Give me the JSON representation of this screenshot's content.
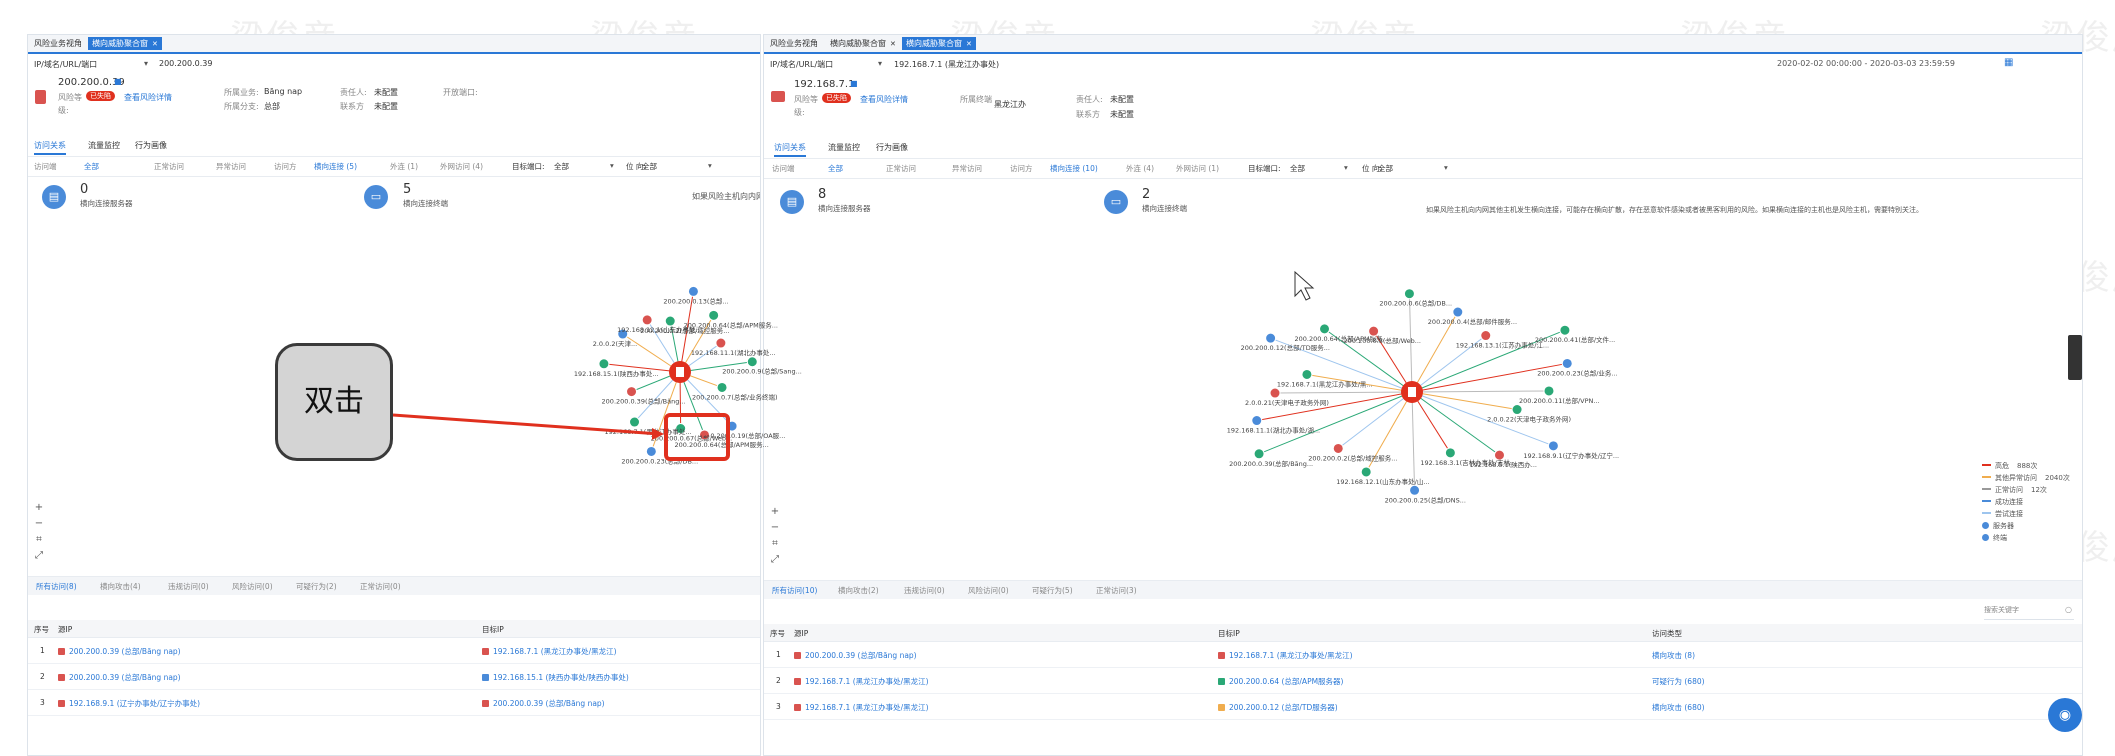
{
  "left": {
    "tabs": [
      "风险业务视角",
      "横向威胁聚合窗"
    ],
    "breadcrumb": {
      "label": "IP/域名/URL/端口",
      "value": "200.200.0.39"
    },
    "host": {
      "ip": "200.200.0.39",
      "risk_label": "风险等",
      "risk_badge": "已失陷",
      "risk_link": "查看风险详情",
      "fields": [
        {
          "k": "所属业务:",
          "v": "Băng nap"
        },
        {
          "k": "所属分支:",
          "v": "总部"
        },
        {
          "k": "责任人:",
          "v": "未配置"
        },
        {
          "k": "联系方",
          "v": "未配置"
        },
        {
          "k": "开放端口:",
          "v": ""
        }
      ],
      "extra_label": "级:"
    },
    "view_tabs": [
      "访问关系",
      "流量监控",
      "行为画像"
    ],
    "filter": {
      "group1_label": "访问端",
      "group1": [
        "全部",
        "正常访问",
        "异常访问"
      ],
      "group2_label": "访问方",
      "group2": [
        "横向连接 (5)",
        "外连 (1)",
        "外网访问 (4)"
      ],
      "dest_label": "目标端口:",
      "dest_value": "全部",
      "pos_label": "位\n向:",
      "pos_value": "全部"
    },
    "stats": [
      {
        "num": "0",
        "label": "横向连接服务器"
      },
      {
        "num": "5",
        "label": "横向连接终端"
      }
    ],
    "hint": "如果风险主机向内网",
    "bottom_tabs": [
      "所有访问(8)",
      "横向攻击(4)",
      "违规访问(0)",
      "风险访问(0)",
      "可疑行为(2)",
      "正常访问(0)"
    ],
    "table": {
      "headers": [
        "序号",
        "源IP",
        "目标IP"
      ],
      "rows": [
        {
          "n": "1",
          "src": "200.200.0.39 (总部/Băng nap)",
          "src_color": "#d9534f",
          "dst": "192.168.7.1 (黑龙江办事处/黑龙江)",
          "dst_color": "#d9534f"
        },
        {
          "n": "2",
          "src": "200.200.0.39 (总部/Băng nap)",
          "src_color": "#d9534f",
          "dst": "192.168.15.1 (陕西办事处/陕西办事处)",
          "dst_color": "#4a8bd9"
        },
        {
          "n": "3",
          "src": "192.168.9.1 (辽宁办事处/辽宁办事处)",
          "src_color": "#d9534f",
          "dst": "200.200.0.39 (总部/Băng nap)",
          "dst_color": "#d9534f"
        }
      ]
    },
    "graph_labels": [
      "200.200.0.7(总部/业务终端)",
      "200.200.0.19(总部/OA服...",
      "200.200.0.64(总部/APM服务...",
      "200.200.0.67(总部/Web...",
      "200.200.0.23(总部/DB...",
      "192.168.7.1(黑龙江办事处...",
      "200.200.0.39(总部/Băng...",
      "192.168.15.1(陕西办事处...",
      "2.0.0.2(天津...",
      "192.168.12.1(山东办事处...",
      "200.200.0.2(总部/域控服务...",
      "200.200.0.13(总部...",
      "200.200.0.64(总部/APM服务...",
      "192.168.11.1(湖北办事处...",
      "200.200.0.9(总部/Sang..."
    ]
  },
  "right": {
    "tabs": [
      "风险业务视角",
      "横向威胁聚合窗",
      "横向威胁聚合窗"
    ],
    "breadcrumb": {
      "label": "IP/域名/URL/端口",
      "value": "192.168.7.1 (黑龙江办事处)"
    },
    "date_range": "2020-02-02 00:00:00 - 2020-03-03 23:59:59",
    "host": {
      "ip": "192.168.7.1",
      "risk_label": "风险等",
      "risk_badge": "已失陷",
      "risk_link": "查看风险详情",
      "fields": [
        {
          "k": "所属终端",
          "v": "黑龙江办"
        },
        {
          "k": "责任人:",
          "v": "未配置"
        },
        {
          "k": "联系方",
          "v": "未配置"
        }
      ],
      "extra_label": "级:"
    },
    "view_tabs": [
      "访问关系",
      "流量监控",
      "行为画像"
    ],
    "filter": {
      "group1_label": "访问端",
      "group1": [
        "全部",
        "正常访问",
        "异常访问"
      ],
      "group2_label": "访问方",
      "group2": [
        "横向连接 (10)",
        "外连 (4)",
        "外网访问 (1)"
      ],
      "dest_label": "目标端口:",
      "dest_value": "全部",
      "pos_label": "位\n向:",
      "pos_value": "全部"
    },
    "stats": [
      {
        "num": "8",
        "label": "横向连接服务器"
      },
      {
        "num": "2",
        "label": "横向连接终端"
      }
    ],
    "hint": "如果风险主机向内网其他主机发生横向连接，可能存在横向扩散，存在恶意软件感染或者被黑客利用的风险。如果横向连接的主机也是风险主机，需要特别关注。",
    "legend": [
      {
        "label": "高危",
        "value": "888次",
        "color": "#e0301e"
      },
      {
        "label": "其他异常访问",
        "value": "2040次",
        "color": "#f0ad4e"
      },
      {
        "label": "正常访问",
        "value": "12次",
        "color": "#999999"
      },
      {
        "label": "成功连接",
        "value": "",
        "color": "#4a8bd9"
      },
      {
        "label": "尝试连接",
        "value": "",
        "color": "#9ec5ee"
      },
      {
        "label": "服务器",
        "value": "",
        "color": "#4a8bd9"
      },
      {
        "label": "终端",
        "value": "",
        "color": "#4a8bd9"
      }
    ],
    "bottom_tabs": [
      "所有访问(10)",
      "横向攻击(2)",
      "违规访问(0)",
      "风险访问(0)",
      "可疑行为(5)",
      "正常访问(3)"
    ],
    "search_placeholder": "搜索关键字",
    "table": {
      "headers": [
        "序号",
        "源IP",
        "目标IP",
        "访问类型"
      ],
      "rows": [
        {
          "n": "1",
          "src": "200.200.0.39 (总部/Băng nap)",
          "src_color": "#d9534f",
          "dst": "192.168.7.1 (黑龙江办事处/黑龙江)",
          "dst_color": "#d9534f",
          "type": "横向攻击 (8)"
        },
        {
          "n": "2",
          "src": "192.168.7.1 (黑龙江办事处/黑龙江)",
          "src_color": "#d9534f",
          "dst": "200.200.0.64 (总部/APM服务器)",
          "dst_color": "#2aa876",
          "type": "可疑行为 (680)"
        },
        {
          "n": "3",
          "src": "192.168.7.1 (黑龙江办事处/黑龙江)",
          "src_color": "#d9534f",
          "dst": "200.200.0.12 (总部/TD服务器)",
          "dst_color": "#f0ad4e",
          "type": "横向攻击 (680)"
        }
      ]
    },
    "graph_labels": [
      "2.0.0.22(天津电子政务外网)",
      "192.168.9.1(辽宁办事处/辽宁...",
      "192.168.5.1(陕西办...",
      "192.168.3.1(吉林办事处/吉林...",
      "200.200.0.25(总部/DNS...",
      "192.168.12.1(山东办事处/山...",
      "200.200.0.2(总部/域控服务...",
      "200.200.0.39(总部/Băng...",
      "192.168.11.1(湖北办事处/湖...",
      "2.0.0.21(天津电子政务外网)",
      "192.168.7.1(黑龙江办事处/黑...",
      "200.200.0.12(总部/TD服务...",
      "200.200.0.64(总部/APM服务...",
      "200.200.0.8(总部/Web...",
      "200.200.0.6(总部/DB...",
      "200.200.0.4(总部/邮件服务...",
      "192.168.13.1(江苏办事处/江...",
      "200.200.0.41(总部/文件...",
      "200.200.0.23(总部/业务...",
      "200.200.0.11(总部/VPN..."
    ]
  },
  "annotation": {
    "callout_text": "双击"
  },
  "watermark": "梁俊彦",
  "colors": {
    "accent": "#2a78d6",
    "danger": "#e0301e",
    "node_green": "#2aa876",
    "node_blue": "#4a8bd9",
    "node_red": "#d9534f"
  },
  "icons": [
    "close-icon",
    "copy-icon",
    "server-icon",
    "terminal-icon",
    "calendar-icon",
    "dropdown-icon",
    "eye-icon",
    "zoom-in-icon",
    "zoom-out-icon",
    "fit-icon"
  ]
}
